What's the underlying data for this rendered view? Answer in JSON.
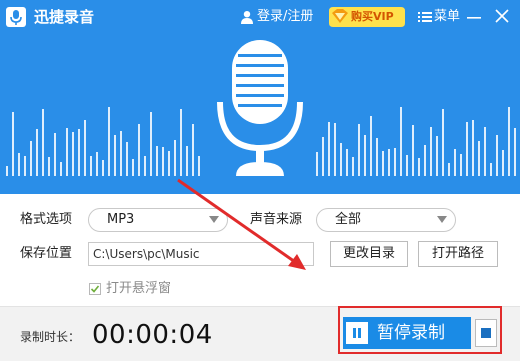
{
  "titlebar": {
    "app_title": "迅捷录音",
    "login_label": "登录/注册",
    "vip_label": "购买VIP",
    "menu_label": "菜单"
  },
  "settings": {
    "format_label": "格式选项",
    "format_value": "MP3",
    "source_label": "声音来源",
    "source_value": "全部",
    "save_label": "保存位置",
    "save_path": "C:\\Users\\pc\\Music",
    "change_dir_label": "更改目录",
    "open_path_label": "打开路径",
    "float_window_label": "打开悬浮窗",
    "float_window_checked": true
  },
  "footer": {
    "duration_label": "录制时长：",
    "timer": "00:00:04",
    "pause_label": "暂停录制"
  },
  "colors": {
    "header": "#2a8ee8",
    "accent": "#1a8be6",
    "annotation_red": "#e12b2b"
  },
  "icons": [
    "microphone-icon",
    "user-icon",
    "diamond-icon",
    "menu-icon",
    "minimize-icon",
    "close-icon",
    "pause-icon",
    "stop-icon"
  ]
}
